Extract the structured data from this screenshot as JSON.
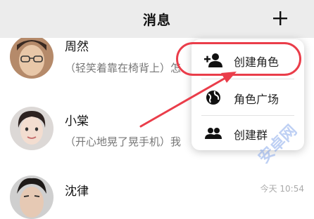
{
  "header": {
    "title": "消息",
    "add_label": "+"
  },
  "conversations": [
    {
      "name": "周然",
      "preview": "（轻笑着靠在椅背上）怎",
      "time": ""
    },
    {
      "name": "小棠",
      "preview": "（开心地晃了晃手机）我",
      "time": ""
    },
    {
      "name": "沈律",
      "preview": "",
      "time": "今天 10:54"
    }
  ],
  "menu": {
    "items": [
      {
        "label": "创建角色",
        "icon": "add-person-icon"
      },
      {
        "label": "角色广场",
        "icon": "globe-icon"
      },
      {
        "label": "创建群",
        "icon": "group-icon"
      }
    ]
  },
  "annotation": {
    "color": "#ea3d4a"
  },
  "watermark": {
    "text": "安卓网"
  }
}
